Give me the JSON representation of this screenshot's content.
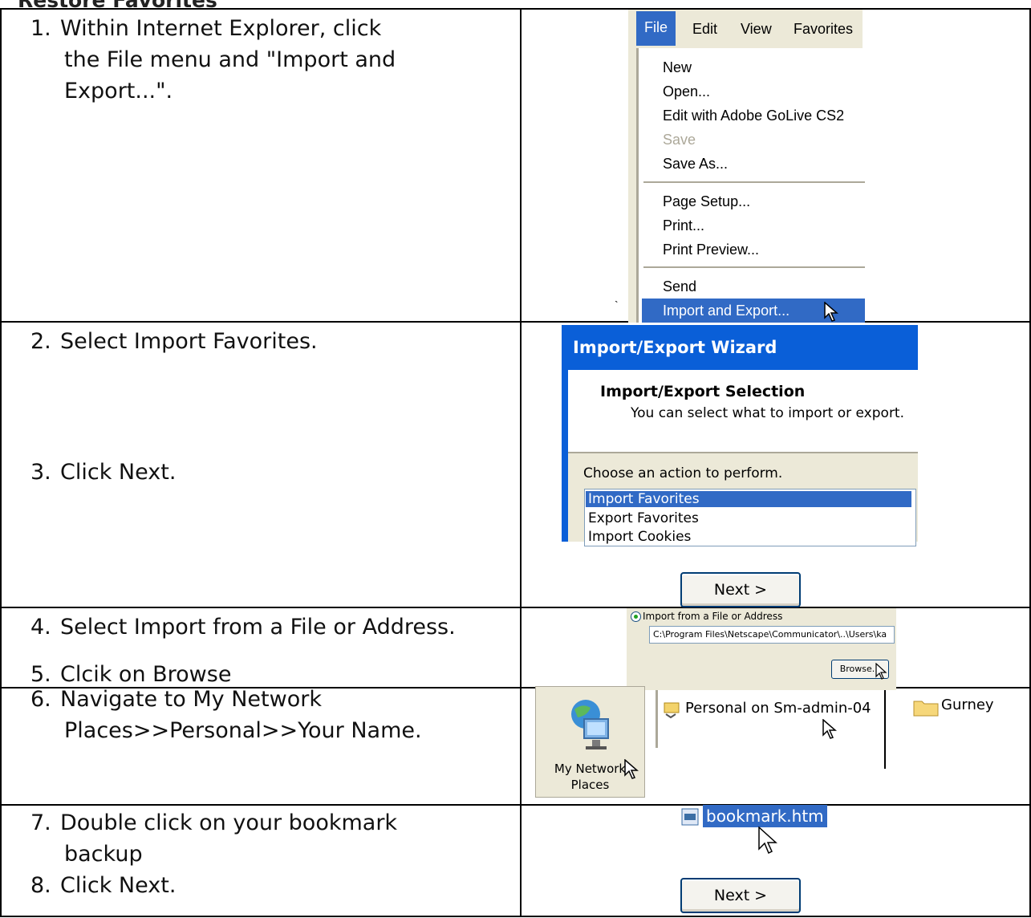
{
  "page_title": "Restore Favorites",
  "steps": {
    "s1": {
      "num": "1.",
      "lines": [
        "Within Internet Explorer, click",
        "the File menu and \"Import and",
        "Export...\"."
      ]
    },
    "s2": {
      "num": "2.",
      "text": "Select Import Favorites."
    },
    "s3": {
      "num": "3.",
      "text": "Click Next."
    },
    "s4": {
      "num": "4.",
      "text": "Select Import from a File or Address."
    },
    "s5": {
      "num": "5.",
      "text": "Clcik on Browse"
    },
    "s6": {
      "num": "6.",
      "lines": [
        "Navigate to My Network",
        "Places>>Personal>>Your Name."
      ]
    },
    "s7": {
      "num": "7.",
      "lines": [
        "Double click on your bookmark",
        "backup"
      ]
    },
    "s8": {
      "num": "8.",
      "text": "Click Next."
    }
  },
  "file_menu": {
    "menubar": [
      "File",
      "Edit",
      "View",
      "Favorites"
    ],
    "items": [
      "New",
      "Open...",
      "Edit with Adobe GoLive CS2",
      "Save",
      "Save As...",
      "Page Setup...",
      "Print...",
      "Print Preview...",
      "Send",
      "Import and Export..."
    ]
  },
  "wizard": {
    "title": "Import/Export Wizard",
    "heading": "Import/Export Selection",
    "subheading": "You can select what to import or export.",
    "prompt": "Choose an action to perform.",
    "actions": [
      "Import Favorites",
      "Export Favorites",
      "Import Cookies"
    ],
    "next_label": "Next >"
  },
  "import_source": {
    "option_label": "Import from a File or Address",
    "path_value": "C:\\Program Files\\Netscape\\Communicator\\..\\Users\\ka",
    "browse_label": "Browse..."
  },
  "navigation": {
    "network_places_label": "My Network Places",
    "personal_item": "Personal on Sm-admin-04",
    "folder_item": "Gurney"
  },
  "bookmark": {
    "file_name": "bookmark.htm",
    "next_label": "Next >"
  },
  "colors": {
    "selection": "#316ac5",
    "xp_title": "#0a5fd8",
    "xp_face": "#ece9d8"
  }
}
